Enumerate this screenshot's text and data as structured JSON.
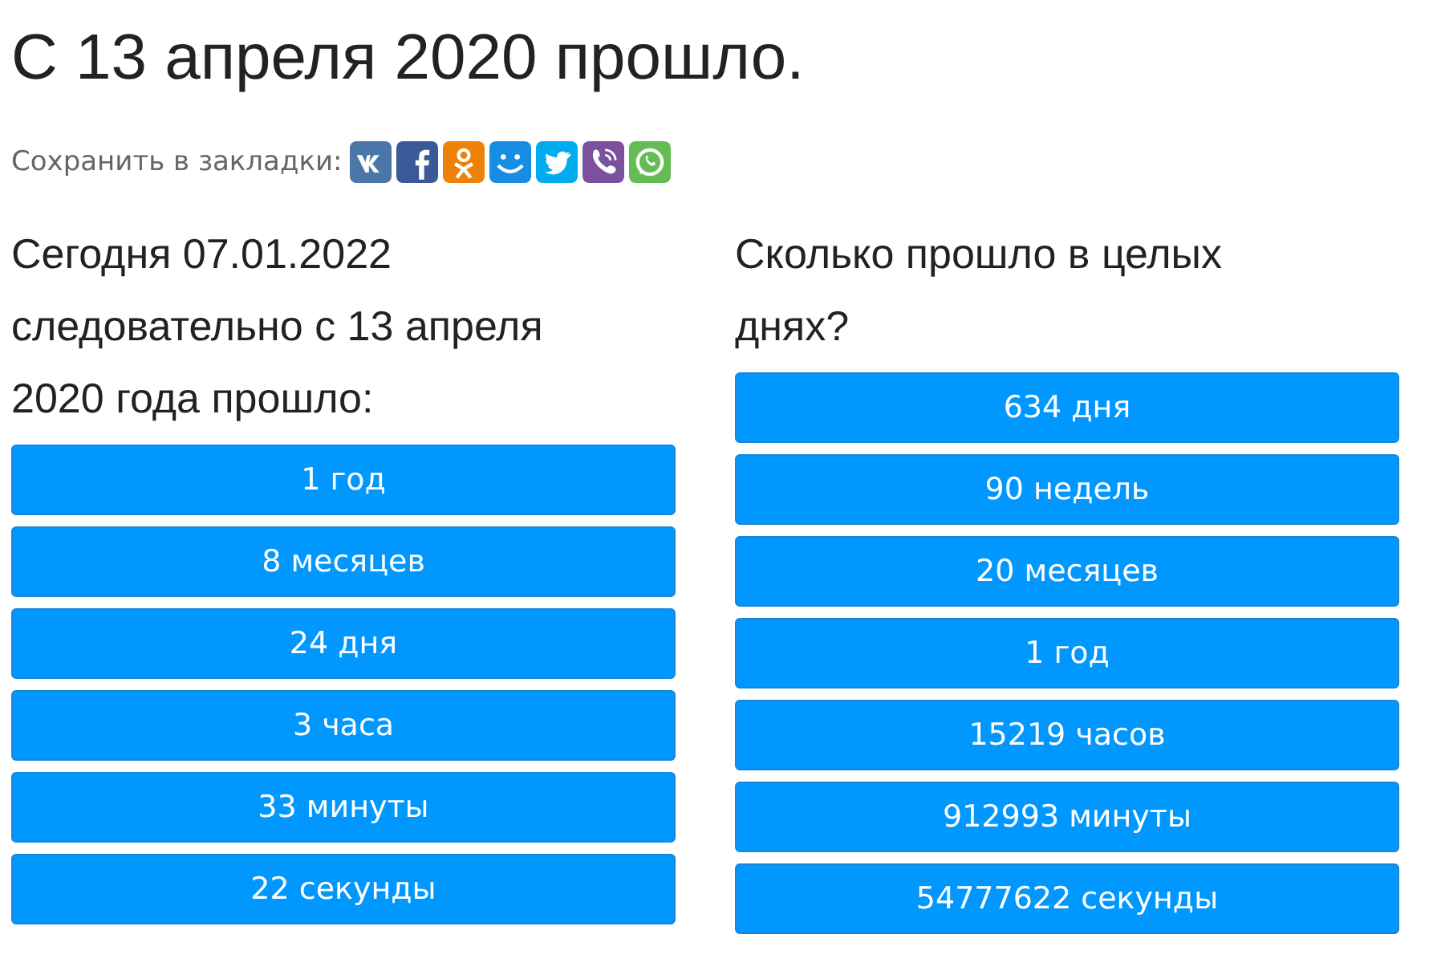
{
  "title": "С 13 апреля 2020 прошло.",
  "share": {
    "label": "Сохранить в закладки:",
    "icons": [
      {
        "kind": "vk",
        "color": "#4a76a8"
      },
      {
        "kind": "facebook",
        "color": "#3b5998"
      },
      {
        "kind": "ok",
        "color": "#ee8208"
      },
      {
        "kind": "smile",
        "color": "#168de2"
      },
      {
        "kind": "twitter",
        "color": "#00aced"
      },
      {
        "kind": "viber",
        "color": "#7b519d"
      },
      {
        "kind": "whatsapp",
        "color": "#65bc54"
      }
    ]
  },
  "columns": [
    {
      "heading": "Сегодня 07.01.2022 следовательно с 13 апреля 2020 года прошло:",
      "items": [
        "1 год",
        "8 месяцев",
        "24 дня",
        "3 часа",
        "33 минуты",
        "22 секунды"
      ]
    },
    {
      "heading": "Сколько прошло в целых днях?",
      "items": [
        "634 дня",
        "90 недель",
        "20 месяцев",
        "1 год",
        "15219 часов",
        "912993 минуты",
        "54777622 секунды"
      ]
    }
  ]
}
